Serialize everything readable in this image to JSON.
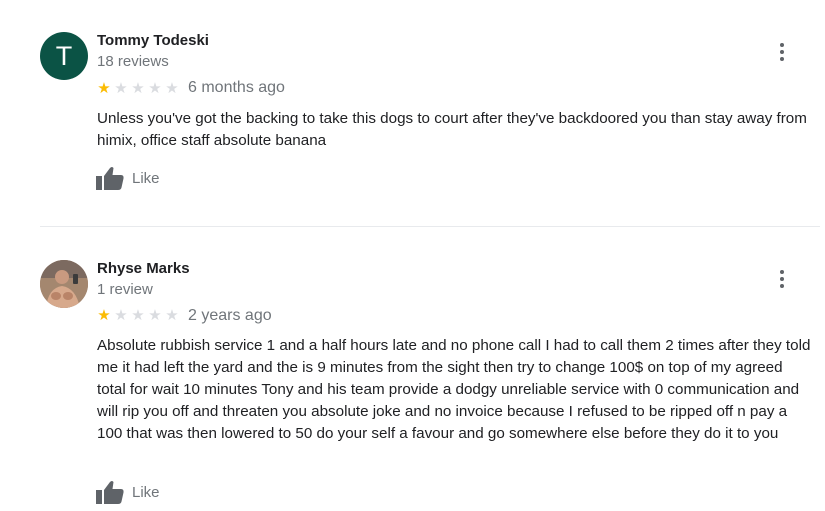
{
  "colors": {
    "star_filled": "#fbbc04",
    "star_empty": "#dadce0",
    "avatar_t_bg": "#0b5345"
  },
  "reviews": [
    {
      "avatar_letter": "T",
      "name": "Tommy Todeski",
      "review_count": "18 reviews",
      "rating": 1,
      "max_rating": 5,
      "age": "6 months ago",
      "text": "Unless you've got the backing to take this dogs to court after they've backdoored you than stay away from himix, office staff absolute banana",
      "like_label": "Like"
    },
    {
      "avatar_letter": "",
      "name": "Rhyse Marks",
      "review_count": "1 review",
      "rating": 1,
      "max_rating": 5,
      "age": "2 years ago",
      "text": "Absolute rubbish service 1 and a half hours late and no phone call I had to call them 2 times after they told me it had left the yard and the is 9 minutes from the sight then try to change 100$ on top of my agreed total for wait 10 minutes Tony and his team provide a dodgy unreliable service with 0 communication and will rip you off and threaten you absolute joke and no invoice because I refused to be ripped off n pay a 100 that was then lowered to 50 do your self a favour and go somewhere else before they do it to you",
      "like_label": "Like"
    }
  ]
}
